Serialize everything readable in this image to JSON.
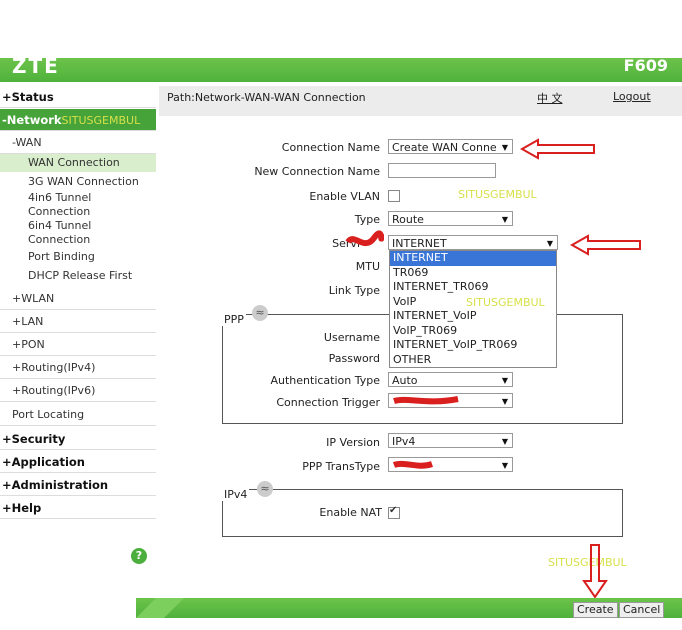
{
  "header": {
    "logo": "ZTE",
    "model": "F609"
  },
  "path": {
    "text": "Path:Network-WAN-WAN Connection",
    "lang": "中 文",
    "logout": "Logout"
  },
  "sidebar": {
    "status": "+Status",
    "network": "-Network",
    "watermark": "SITUSGEMBUL",
    "wan": "-WAN",
    "wan_items": [
      "WAN Connection",
      "3G WAN Connection",
      "4in6 Tunnel",
      "Connection",
      "6in4 Tunnel",
      "Connection",
      "Port Binding",
      "DHCP Release First"
    ],
    "wlan": "+WLAN",
    "lan": "+LAN",
    "pon": "+PON",
    "routing4": "+Routing(IPv4)",
    "routing6": "+Routing(IPv6)",
    "port_locating": "Port Locating",
    "security": "+Security",
    "application": "+Application",
    "administration": "+Administration",
    "help": "+Help",
    "help_icon": "?"
  },
  "form": {
    "connection_name_label": "Connection Name",
    "connection_name_value": "Create WAN Conne",
    "new_connection_name_label": "New Connection Name",
    "new_connection_name_value": "",
    "enable_vlan_label": "Enable VLAN",
    "type_label": "Type",
    "type_value": "Route",
    "service_label": "Servi",
    "service_value": "INTERNET",
    "mtu_label": "MTU",
    "link_type_label": "Link Type",
    "ppp_title": "PPP",
    "username_label": "Username",
    "password_label": "Password",
    "auth_type_label": "Authentication Type",
    "auth_type_value": "Auto",
    "conn_trigger_label": "Connection Trigger",
    "ip_version_label": "IP Version",
    "ip_version_value": "IPv4",
    "ppp_transtype_label": "PPP TransType",
    "ipv4_title": "IPv4",
    "enable_nat_label": "Enable NAT"
  },
  "dropdown": {
    "options": [
      "INTERNET",
      "TR069",
      "INTERNET_TR069",
      "VoIP",
      "INTERNET_VoIP",
      "VoIP_TR069",
      "INTERNET_VoIP_TR069",
      "OTHER"
    ],
    "selected": "INTERNET"
  },
  "watermarks": {
    "w1": "SITUSGEMBUL",
    "w2": "SITUSGEMBUL",
    "w3": "SITUSGEMBUL"
  },
  "buttons": {
    "create": "Create",
    "cancel": "Cancel"
  },
  "colors": {
    "brand_green": "#4fb23b",
    "annotation_red": "#d9201f",
    "highlight": "#3875d7"
  }
}
